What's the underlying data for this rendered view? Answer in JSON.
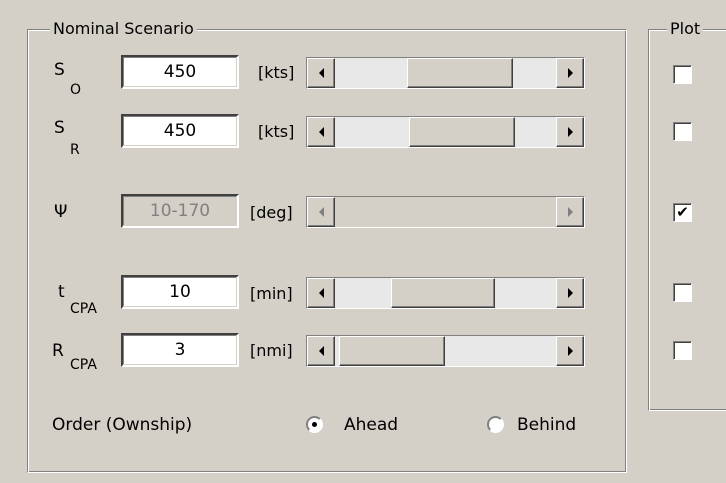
{
  "nominal_scenario": {
    "title": "Nominal Scenario",
    "rows": [
      {
        "main": "S",
        "sub": "O",
        "value": "450",
        "unit": "[kts]",
        "enabled": true,
        "slider_fraction": 0.5
      },
      {
        "main": "S",
        "sub": "R",
        "value": "450",
        "unit": "[kts]",
        "enabled": true,
        "slider_fraction": 0.5
      },
      {
        "main": "Ψ",
        "sub": "",
        "value": "10-170",
        "unit": "[deg]",
        "enabled": false
      },
      {
        "main": "t",
        "sub": "CPA",
        "value": "10",
        "unit": "[min]",
        "enabled": true,
        "slider_fraction": 0.33
      },
      {
        "main": "R",
        "sub": "CPA",
        "value": "3",
        "unit": "[nmi]",
        "enabled": true,
        "slider_fraction": 0.1
      }
    ],
    "order": {
      "label": "Order (Ownship)",
      "ahead_label": "Ahead",
      "behind_label": "Behind",
      "selected": "Ahead"
    }
  },
  "plot": {
    "title": "Plot",
    "checkboxes": [
      false,
      false,
      true,
      false,
      false
    ]
  }
}
